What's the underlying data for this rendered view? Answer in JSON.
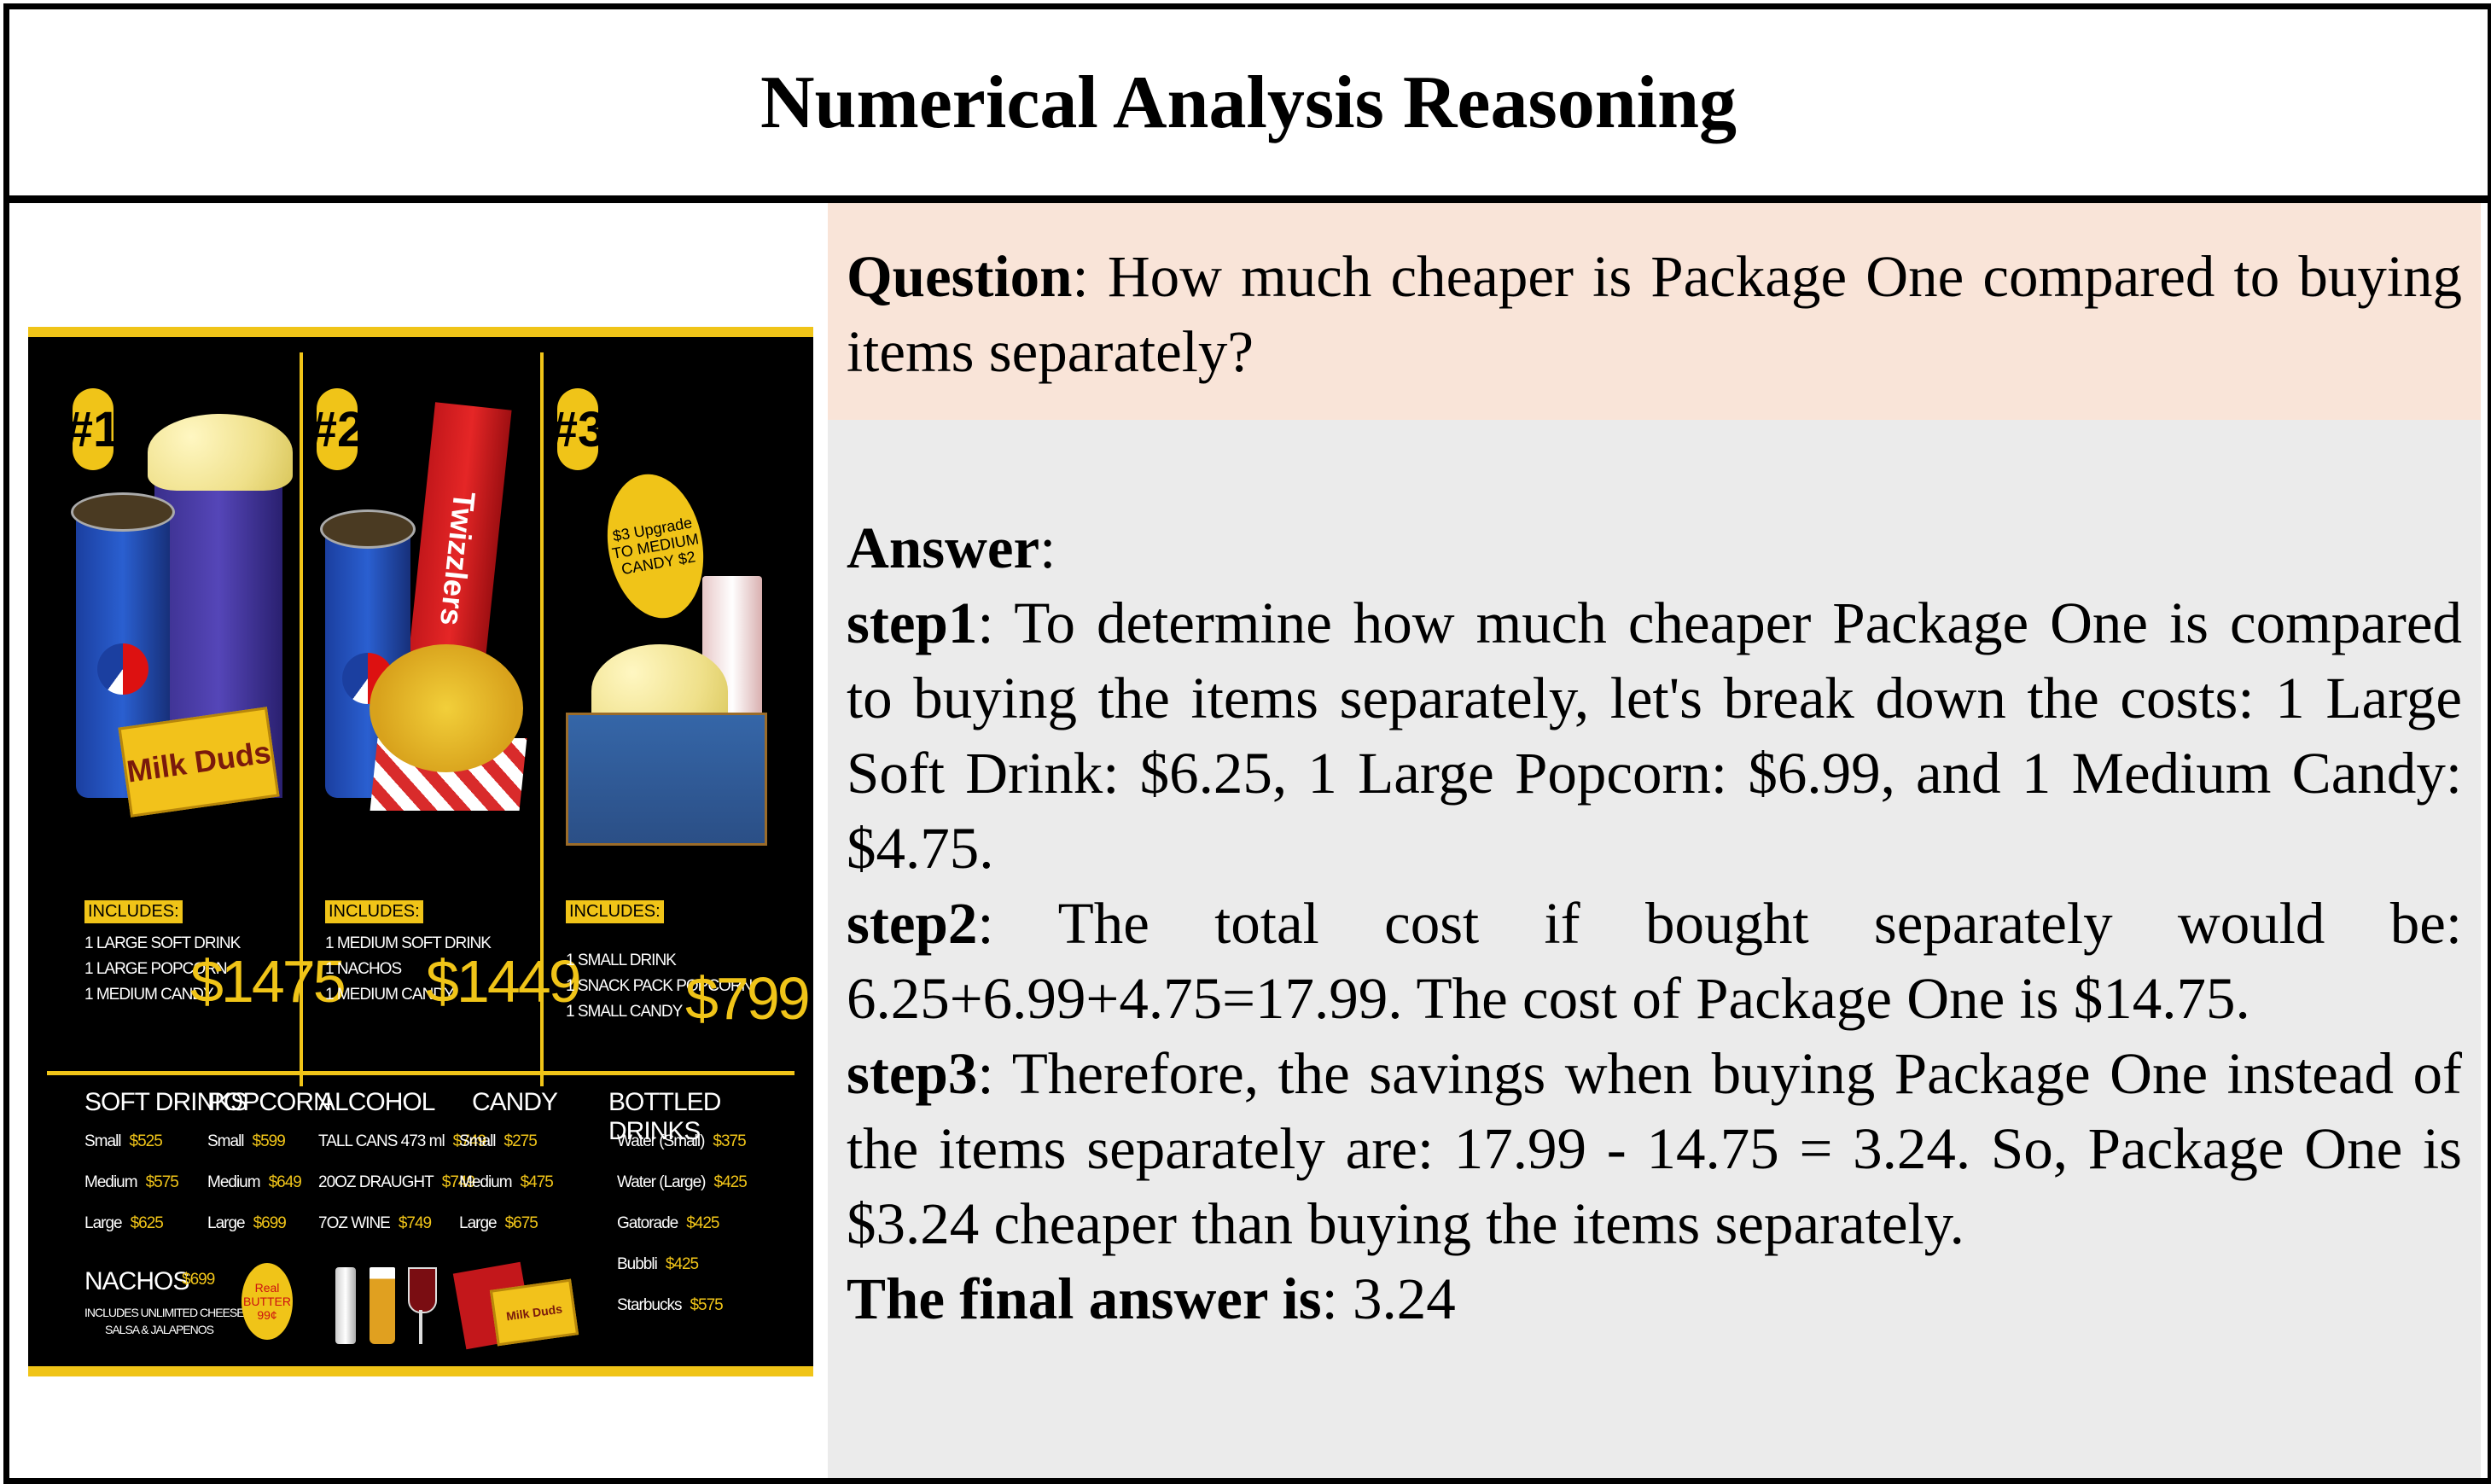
{
  "title": "Numerical Analysis Reasoning",
  "question": {
    "label": "Question",
    "text": ": How much cheaper is Package One compared to buying items separately?"
  },
  "answer": {
    "label": "Answer",
    "colon": ":",
    "steps": [
      {
        "label": "step1",
        "text": ": To determine how much cheaper Package One is compared to buying the items separately, let's break down the costs: 1 Large Soft Drink: $6.25, 1 Large Popcorn: $6.99, and 1 Medium Candy: $4.75."
      },
      {
        "label": "step2",
        "text": ": The total cost if bought separately would be: 6.25+6.99+4.75=17.99. The cost of Package One is $14.75."
      },
      {
        "label": "step3",
        "text": ": Therefore, the savings when buying Package One instead of the items separately are: 17.99 - 14.75 = 3.24. So, Package One is $3.24 cheaper than buying the items separately."
      }
    ],
    "final_label": "The final answer is",
    "final_value": ": 3.24"
  },
  "menu": {
    "packages": [
      {
        "badge": "#1",
        "includes": "INCLUDES:",
        "items": [
          "1 LARGE SOFT DRINK",
          "1 LARGE POPCORN",
          "1 MEDIUM CANDY"
        ],
        "price": "$1475",
        "candy": "Milk Duds"
      },
      {
        "badge": "#2",
        "includes": "INCLUDES:",
        "items": [
          "1 MEDIUM SOFT DRINK",
          "1 NACHOS",
          "1 MEDIUM CANDY"
        ],
        "price": "$1449",
        "candy": "Twizzlers"
      },
      {
        "badge": "#3",
        "includes": "INCLUDES:",
        "items": [
          "1 SMALL DRINK",
          "1 SNACK PACK POPCORN",
          "1 SMALL CANDY"
        ],
        "price": "$799",
        "upgrade": "$3 Upgrade TO MEDIUM CANDY $2"
      }
    ],
    "soft_drinks": {
      "title": "SOFT DRINKS",
      "rows": [
        {
          "size": "Small",
          "price": "$525"
        },
        {
          "size": "Medium",
          "price": "$575"
        },
        {
          "size": "Large",
          "price": "$625"
        }
      ]
    },
    "popcorn": {
      "title": "POPCORN",
      "rows": [
        {
          "size": "Small",
          "price": "$599"
        },
        {
          "size": "Medium",
          "price": "$649"
        },
        {
          "size": "Large",
          "price": "$699"
        }
      ]
    },
    "alcohol": {
      "title": "ALCOHOL",
      "rows": [
        {
          "size": "TALL CANS 473 ml",
          "price": "$749"
        },
        {
          "size": "20OZ DRAUGHT",
          "price": "$749"
        },
        {
          "size": "7OZ WINE",
          "price": "$749"
        }
      ]
    },
    "candy": {
      "title": "CANDY",
      "rows": [
        {
          "size": "Small",
          "price": "$275"
        },
        {
          "size": "Medium",
          "price": "$475"
        },
        {
          "size": "Large",
          "price": "$675"
        }
      ]
    },
    "bottled_drinks": {
      "title": "BOTTLED DRINKS",
      "rows": [
        {
          "size": "Water (Small)",
          "price": "$375"
        },
        {
          "size": "Water (Large)",
          "price": "$425"
        },
        {
          "size": "Gatorade",
          "price": "$425"
        },
        {
          "size": "Bubbli",
          "price": "$425"
        },
        {
          "size": "Starbucks",
          "price": "$575"
        }
      ]
    },
    "nachos": {
      "title": "NACHOS",
      "price": "$699",
      "note1": "INCLUDES UNLIMITED CHEESE,",
      "note2": "SALSA & JALAPENOS"
    },
    "butter": {
      "text": "Real BUTTER 99¢"
    }
  }
}
